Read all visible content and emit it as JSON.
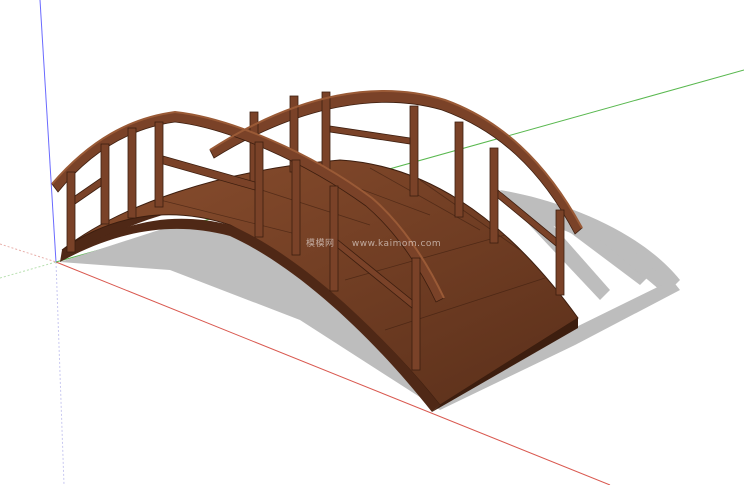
{
  "viewport": {
    "background": "#ffffff",
    "axes": {
      "red_axis_color": "#d9584f",
      "green_axis_color": "#59b84f",
      "blue_axis_color": "#6a6aff"
    }
  },
  "model": {
    "wood_color": "#7a4228",
    "wood_dark": "#4f2816",
    "deck_color": "#6e3b22",
    "shadow_color": "#bdbdbd"
  },
  "watermark": {
    "brand": "模模网",
    "url": "www.kaimom.com"
  }
}
